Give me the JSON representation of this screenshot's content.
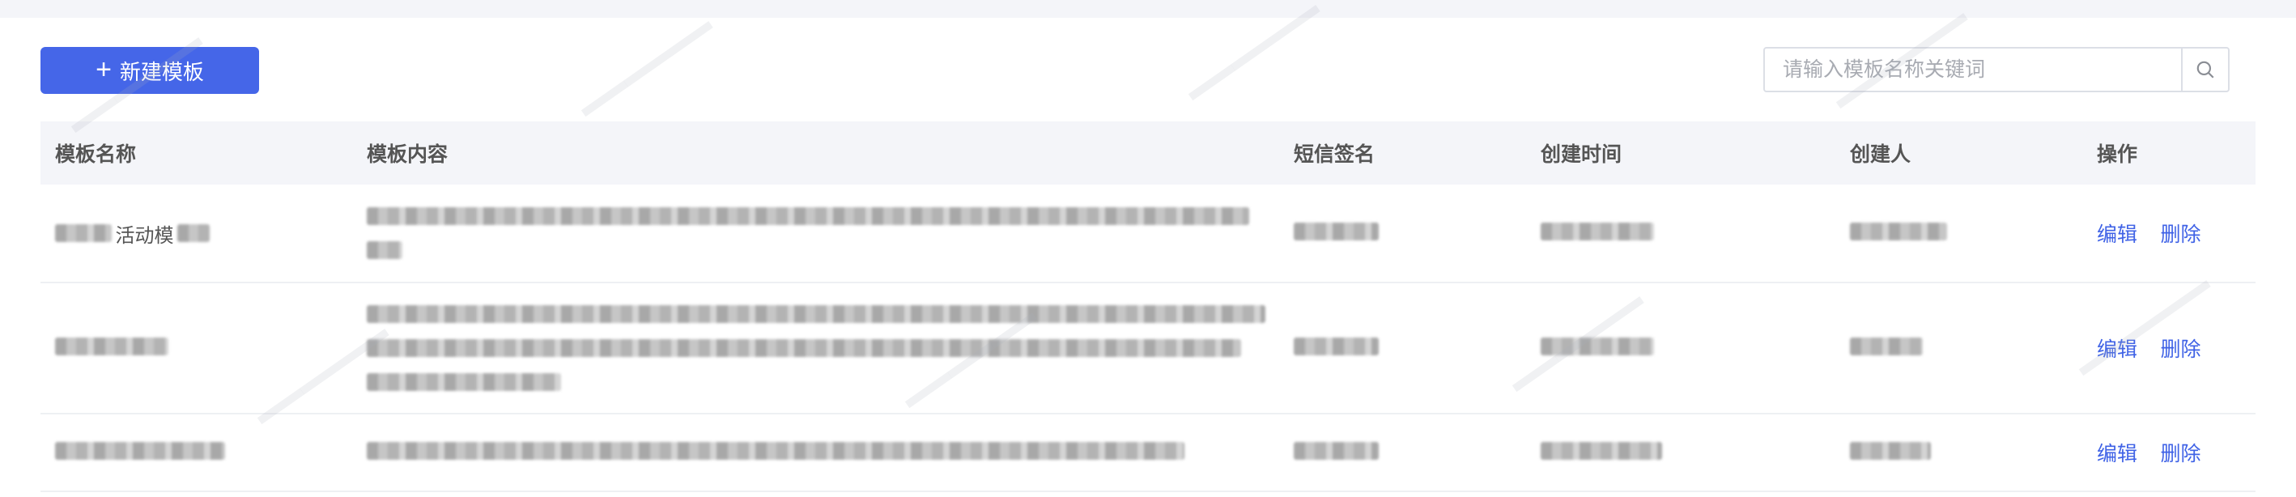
{
  "toolbar": {
    "new_button_label": "新建模板",
    "search_placeholder": "请输入模板名称关键词"
  },
  "table": {
    "headers": [
      "模板名称",
      "模板内容",
      "短信签名",
      "创建时间",
      "创建人",
      "操作"
    ],
    "rows": [
      {
        "name_visible": "活动模",
        "actions": [
          "编辑",
          "删除"
        ]
      },
      {
        "actions": [
          "编辑",
          "删除"
        ]
      },
      {
        "actions": [
          "编辑",
          "删除"
        ]
      }
    ]
  },
  "colors": {
    "primary": "#4566e8",
    "link": "#3f62e6",
    "header_bg": "#f4f5f9"
  },
  "icons": {
    "new_button": "plus-icon",
    "search": "search-icon"
  }
}
